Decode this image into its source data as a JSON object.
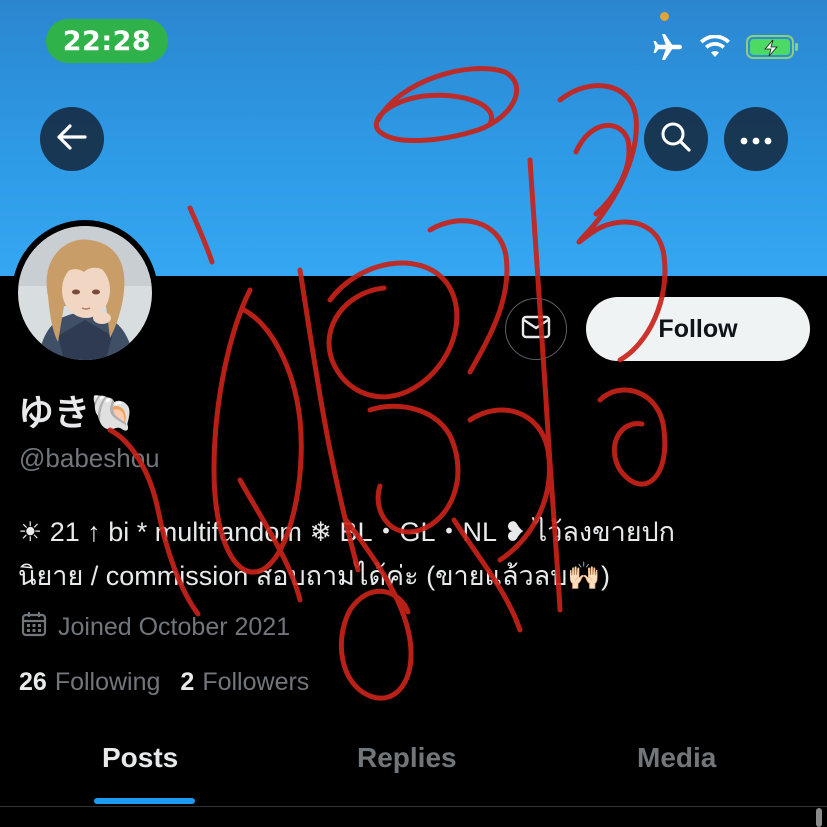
{
  "status_bar": {
    "time": "22:28",
    "icons": [
      "airplane-icon",
      "wifi-icon",
      "battery-charging-icon"
    ],
    "pill_color": "#30b24a"
  },
  "header": {
    "back_icon": "arrow-left-icon",
    "search_icon": "search-icon",
    "more_icon": "more-icon",
    "banner_color": "#2e9ae6"
  },
  "profile": {
    "name": "ゆき🐚",
    "handle": "@babeshou",
    "bio_line1": "☀ 21 ↑ bi * multifandom ❄ BL・GL・NL ❥ ไว้ลงขายปก",
    "bio_line2": "นิยาย / commission สอบถามได้ค่ะ (ขายแล้วลบ🙌🏻)",
    "joined": "Joined October 2021",
    "following_count": "26",
    "following_label": "Following",
    "followers_count": "2",
    "followers_label": "Followers"
  },
  "actions": {
    "message_icon": "envelope-icon",
    "follow_label": "Follow"
  },
  "tabs": [
    {
      "label": "Posts",
      "active": true
    },
    {
      "label": "Replies",
      "active": false
    },
    {
      "label": "Media",
      "active": false
    }
  ],
  "accent_color": "#1d9bf0",
  "overlay": {
    "type": "hand-drawn red scribble",
    "color": "#c8231a"
  }
}
